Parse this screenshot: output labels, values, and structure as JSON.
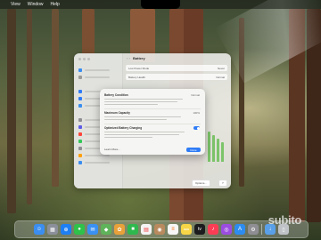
{
  "menubar": {
    "apple_glyph": "",
    "items": [
      "View",
      "Window",
      "Help"
    ]
  },
  "settings_window": {
    "title": "Battery",
    "nav_arrows": "‹ ›",
    "rows": [
      {
        "label": "Low Power Mode",
        "value": "Never"
      },
      {
        "label": "Battery Health",
        "value": "Normal"
      }
    ],
    "footer_buttons": [
      "Options...",
      "?"
    ]
  },
  "battery_health_sheet": {
    "title": "Battery Condition",
    "title_value": "Normal",
    "max_capacity_label": "Maximum Capacity",
    "max_capacity_value": "100%",
    "optimized_label": "Optimized Battery Charging",
    "optimized_enabled": true,
    "learn_more": "Learn More...",
    "done": "Done"
  },
  "dock": {
    "apps": [
      {
        "name": "finder",
        "glyph": "☺",
        "color": "#3b8ef0"
      },
      {
        "name": "launchpad",
        "glyph": "▦",
        "color": "#8a8f99"
      },
      {
        "name": "safari",
        "glyph": "⊕",
        "color": "#1d7ff2"
      },
      {
        "name": "messages",
        "glyph": "●",
        "color": "#2ec24a"
      },
      {
        "name": "mail",
        "glyph": "✉",
        "color": "#3a91f2"
      },
      {
        "name": "maps",
        "glyph": "◆",
        "color": "#5fb35a"
      },
      {
        "name": "photos",
        "glyph": "✿",
        "color": "#e8a13a"
      },
      {
        "name": "facetime",
        "glyph": "■",
        "color": "#2fb84e"
      },
      {
        "name": "calendar",
        "glyph": "▤",
        "color": "#f4f4f4"
      },
      {
        "name": "contacts",
        "glyph": "◉",
        "color": "#b98a5e"
      },
      {
        "name": "reminders",
        "glyph": "≡",
        "color": "#f7f7f7"
      },
      {
        "name": "notes",
        "glyph": "▬",
        "color": "#f6d547"
      },
      {
        "name": "tv",
        "glyph": "tv",
        "color": "#1c1c1e"
      },
      {
        "name": "music",
        "glyph": "♪",
        "color": "#fa3d55"
      },
      {
        "name": "podcasts",
        "glyph": "◎",
        "color": "#9b4de0"
      },
      {
        "name": "app-store",
        "glyph": "A",
        "color": "#2d8cf0"
      },
      {
        "name": "system-settings",
        "glyph": "⚙",
        "color": "#8e8e93"
      }
    ],
    "trailing": [
      {
        "name": "downloads",
        "glyph": "↓",
        "color": "#5aa0e8"
      },
      {
        "name": "trash",
        "glyph": "▯",
        "color": "#bfc3c7"
      }
    ]
  },
  "watermark": {
    "text": "subito"
  },
  "colors": {
    "accent": "#2f7cf6",
    "toggle_on": "#2f7cf6"
  }
}
